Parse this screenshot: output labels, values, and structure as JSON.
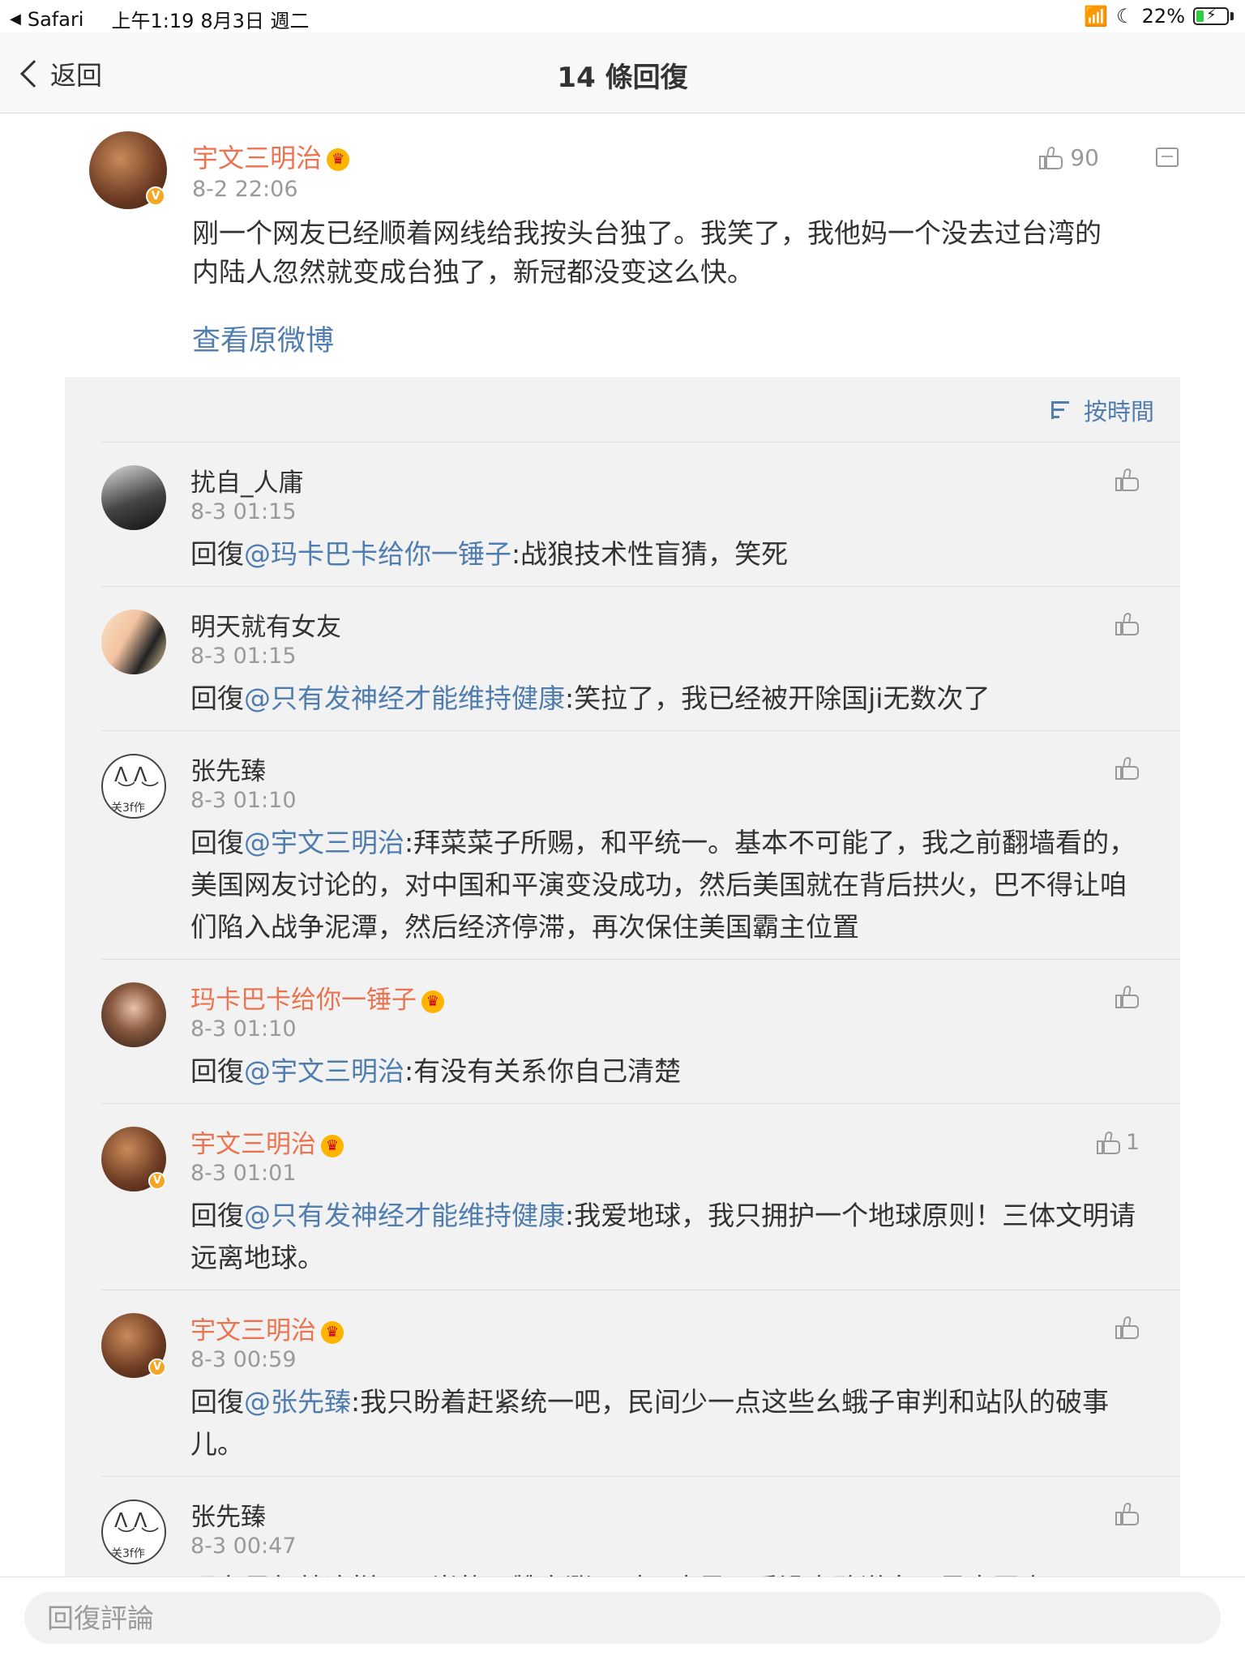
{
  "status": {
    "app": "Safari",
    "time": "上午1:19",
    "date": "8月3日 週二",
    "battery": "22%",
    "battery_level": 0.22
  },
  "nav": {
    "back_label": "返回",
    "title": "14 條回復"
  },
  "post": {
    "author": "宇文三明治",
    "time": "8-2 22:06",
    "text": "刚一个网友已经顺着网线给我按头台独了。我笑了，我他妈一个没去过台湾的内陆人忽然就变成台独了，新冠都没变这么快。",
    "likes": "90",
    "view_original": "查看原微博"
  },
  "sort_label": "按時間",
  "reply_prefix": "回復",
  "replies": [
    {
      "author": "扰自_人庸",
      "time": "8-3 01:15",
      "mention": "@玛卡巴卡给你一锤子",
      "text": ":战狼技术性盲猜，笑死",
      "likes": ""
    },
    {
      "author": "明天就有女友",
      "time": "8-3 01:15",
      "mention": "@只有发神经才能维持健康",
      "text": ":笑拉了，我已经被开除国ji无数次了",
      "likes": ""
    },
    {
      "author": "张先臻",
      "time": "8-3 01:10",
      "mention": "@宇文三明治",
      "text": ":拜菜菜子所赐，和平统一。基本不可能了，我之前翻墙看的，美国网友讨论的，对中国和平演变没成功，然后美国就在背后拱火，巴不得让咱们陷入战争泥潭，然后经济停滞，再次保住美国霸主位置",
      "likes": ""
    },
    {
      "author": "玛卡巴卡给你一锤子",
      "time": "8-3 01:10",
      "mention": "@宇文三明治",
      "text": ":有没有关系你自己清楚",
      "likes": ""
    },
    {
      "author": "宇文三明治",
      "time": "8-3 01:01",
      "mention": "@只有发神经才能维持健康",
      "text": ":我爱地球，我只拥护一个地球原则！三体文明请远离地球。",
      "likes": "1"
    },
    {
      "author": "宇文三明治",
      "time": "8-3 00:59",
      "mention": "@张先臻",
      "text": ":我只盼着赶紧统一吧，民间少一点这些幺蛾子审判和站队的破事儿。",
      "likes": ""
    },
    {
      "author": "张先臻",
      "time": "8-3 00:47",
      "mention": "",
      "text": "现在风气就这样，开炭的只赞高涨，对面也是凡垂没人敢说自己是中国人",
      "likes": ""
    }
  ],
  "avatar_marks": {
    "cat_sig": "关3f作"
  },
  "verified_badge": "V",
  "crown_glyph": "♛",
  "comment_input": {
    "placeholder": "回復評論"
  },
  "colors": {
    "accent_link": "#507daf",
    "member_name": "#eb7350",
    "verified": "#f5a623",
    "background_panel": "#f2f2f2"
  }
}
